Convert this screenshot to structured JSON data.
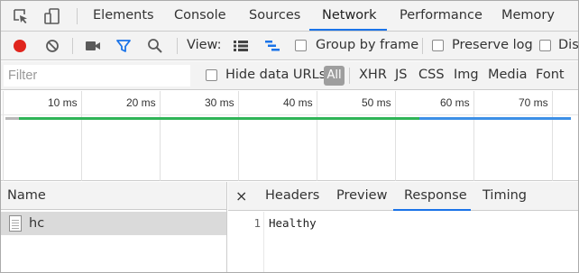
{
  "tabbar": {
    "tabs": [
      "Elements",
      "Console",
      "Sources",
      "Network",
      "Performance",
      "Memory"
    ],
    "active_tab": "Network",
    "accent": "#1a73e8"
  },
  "toolbar": {
    "view_label": "View:",
    "group_by_frame": "Group by frame",
    "preserve_log": "Preserve log",
    "disable_cache": "Disa",
    "record_color": "#e0251d"
  },
  "filterbar": {
    "filter_placeholder": "Filter",
    "hide_data_urls": "Hide data URLs",
    "types": [
      "All",
      "XHR",
      "JS",
      "CSS",
      "Img",
      "Media",
      "Font"
    ]
  },
  "timeline": {
    "ticks": [
      "10 ms",
      "20 ms",
      "30 ms",
      "40 ms",
      "50 ms",
      "60 ms",
      "70 ms"
    ]
  },
  "requests": {
    "column_header": "Name",
    "items": [
      {
        "name": "hc"
      }
    ]
  },
  "details": {
    "close_symbol": "×",
    "tabs": [
      "Headers",
      "Preview",
      "Response",
      "Timing"
    ],
    "active_tab": "Response",
    "response_lines": [
      {
        "line": "1",
        "text": "Healthy"
      }
    ]
  }
}
